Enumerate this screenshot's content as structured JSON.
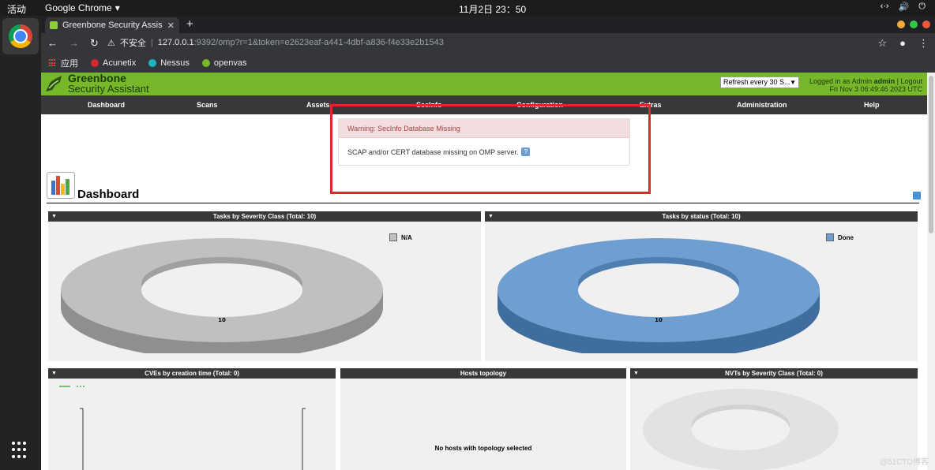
{
  "os": {
    "activities": "活动",
    "app_name": "Google Chrome",
    "clock": "11月2日 23：50",
    "tray_network": "‹·›",
    "tray_volume": "🔊",
    "tray_power": "⏻"
  },
  "browser": {
    "tab_title": "Greenbone Security Assis",
    "insecure_label": "不安全",
    "url_host": "127.0.0.1",
    "url_path": ":9392/omp?r=1&token=e2623eaf-a441-4dbf-a836-f4e33e2b1543",
    "bookmarks": [
      {
        "label": "应用",
        "icon": "apps-grid-icon"
      },
      {
        "label": "Acunetix",
        "icon": "acunetix-icon"
      },
      {
        "label": "Nessus",
        "icon": "nessus-icon"
      },
      {
        "label": "openvas",
        "icon": "openvas-icon"
      }
    ]
  },
  "gsa": {
    "title_line1": "Greenbone",
    "title_line2": "Security Assistant",
    "refresh_select": "Refresh every 30 S...",
    "logged_in_prefix": "Logged in as",
    "role": "Admin",
    "username": "admin",
    "logout": "Logout",
    "datetime": "Fri Nov 3 06:49:46 2023 UTC",
    "nav": [
      "Dashboard",
      "Scans",
      "Assets",
      "SecInfo",
      "Configuration",
      "Extras",
      "Administration",
      "Help"
    ],
    "warning": {
      "title": "Warning: SecInfo Database Missing",
      "body": "SCAP and/or CERT database missing on OMP server."
    },
    "dashboard_title": "Dashboard",
    "panels": {
      "severity": {
        "title": "Tasks by Severity Class (Total: 10)",
        "legend": "N/A",
        "value_label": "10"
      },
      "status": {
        "title": "Tasks by status (Total: 10)",
        "legend": "Done",
        "value_label": "10"
      },
      "cves": {
        "title": "CVEs by creation time (Total: 0)"
      },
      "hosts": {
        "title": "Hosts topology",
        "empty": "No hosts with topology selected"
      },
      "nvts": {
        "title": "NVTs by Severity Class (Total: 0)"
      }
    }
  },
  "colors": {
    "gsa_green": "#76b82a",
    "nav_dark": "#383838",
    "warning_bg": "#f2dede",
    "highlight_red": "#e3262a",
    "na_gray": "#c0c0c0",
    "done_blue": "#6e9fd0"
  },
  "watermark": "@51CTO博客"
}
